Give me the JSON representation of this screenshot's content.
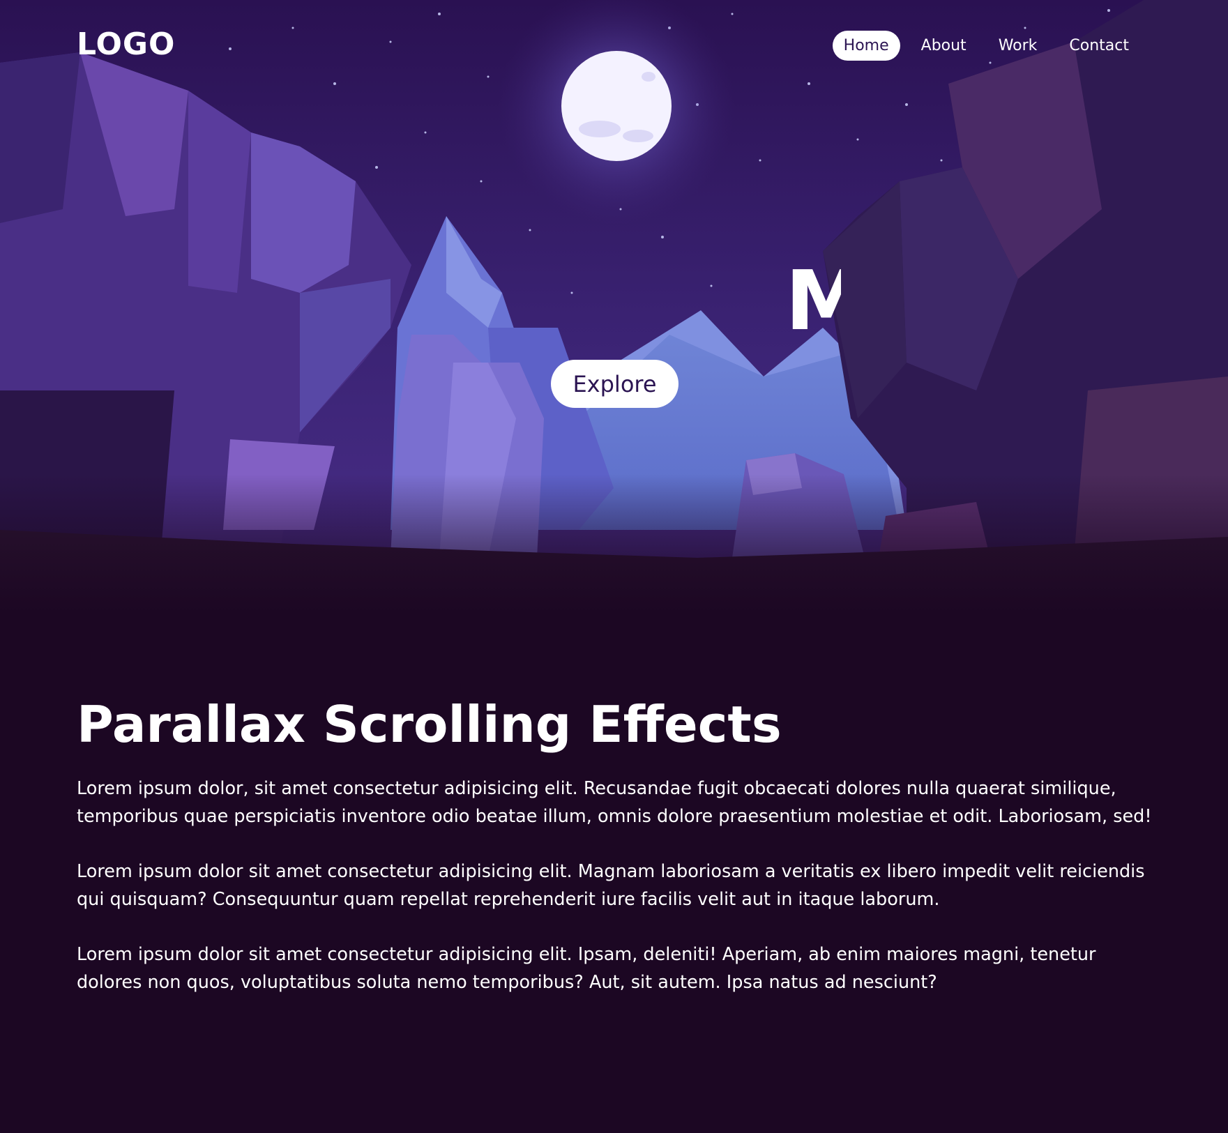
{
  "header": {
    "logo": "LOGO",
    "nav": [
      {
        "label": "Home",
        "active": true
      },
      {
        "label": "About",
        "active": false
      },
      {
        "label": "Work",
        "active": false
      },
      {
        "label": "Contact",
        "active": false
      }
    ]
  },
  "hero": {
    "headline": "M",
    "explore_label": "Explore"
  },
  "content": {
    "title": "Parallax Scrolling Effects",
    "paragraphs": [
      "Lorem ipsum dolor, sit amet consectetur adipisicing elit. Recusandae fugit obcaecati dolores nulla quaerat similique, temporibus quae perspiciatis inventore odio beatae illum, omnis dolore praesentium molestiae et odit. Laboriosam, sed!",
      "Lorem ipsum dolor sit amet consectetur adipisicing elit. Magnam laboriosam a veritatis ex libero impedit velit reiciendis qui quisquam? Consequuntur quam repellat reprehenderit iure facilis velit aut in itaque laborum.",
      "Lorem ipsum dolor sit amet consectetur adipisicing elit. Ipsam, deleniti! Aperiam, ab enim maiores magni, tenetur dolores non quos, voluptatibus soluta nemo temporibus? Aut, sit autem. Ipsa natus ad nesciunt?"
    ]
  },
  "colors": {
    "sky_top": "#2a1152",
    "sky_bottom": "#4a2f8a",
    "page_bg": "#1c0723",
    "moon": "#f4f2ff",
    "mountain_far": "#7f90e0",
    "mountain_mid": "#6a73d4",
    "cliff_purple": "#5b3aa3",
    "cliff_dark": "#2a1548",
    "button_text": "#2b1452"
  }
}
